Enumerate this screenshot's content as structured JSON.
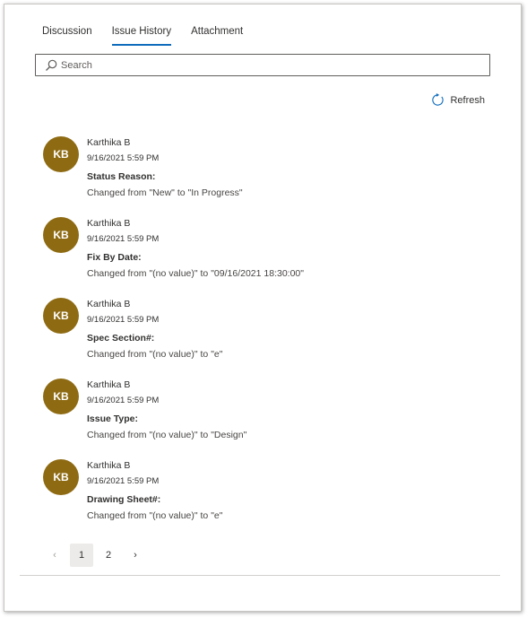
{
  "tabs": [
    {
      "label": "Discussion",
      "active": false
    },
    {
      "label": "Issue History",
      "active": true
    },
    {
      "label": "Attachment",
      "active": false
    }
  ],
  "search": {
    "placeholder": "Search",
    "icon": "search-icon"
  },
  "refresh": {
    "label": "Refresh",
    "icon": "refresh-icon"
  },
  "colors": {
    "avatar_bg": "#8e6b13",
    "tab_underline": "#0f6cbd"
  },
  "history": [
    {
      "initials": "KB",
      "author": "Karthika B",
      "timestamp": "9/16/2021 5:59 PM",
      "field": "Status Reason:",
      "change": "Changed from \"New\" to \"In Progress\""
    },
    {
      "initials": "KB",
      "author": "Karthika B",
      "timestamp": "9/16/2021 5:59 PM",
      "field": "Fix By Date:",
      "change": "Changed from \"(no value)\" to \"09/16/2021 18:30:00\""
    },
    {
      "initials": "KB",
      "author": "Karthika B",
      "timestamp": "9/16/2021 5:59 PM",
      "field": "Spec Section#:",
      "change": "Changed from \"(no value)\" to \"e\""
    },
    {
      "initials": "KB",
      "author": "Karthika B",
      "timestamp": "9/16/2021 5:59 PM",
      "field": "Issue Type:",
      "change": "Changed from \"(no value)\" to \"Design\""
    },
    {
      "initials": "KB",
      "author": "Karthika B",
      "timestamp": "9/16/2021 5:59 PM",
      "field": "Drawing Sheet#:",
      "change": "Changed from \"(no value)\" to \"e\""
    }
  ],
  "pagination": {
    "prev": "‹",
    "pages": [
      "1",
      "2"
    ],
    "current": "1",
    "next": "›"
  }
}
